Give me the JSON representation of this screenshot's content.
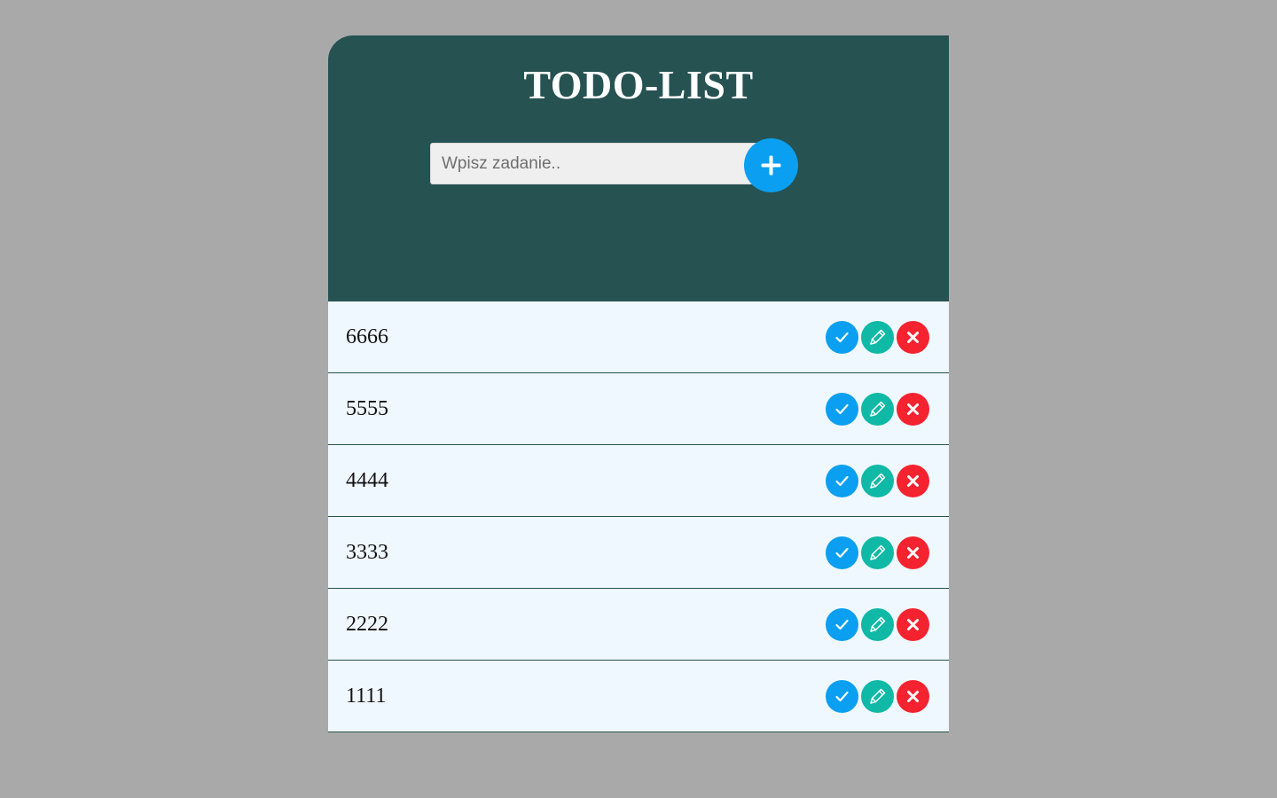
{
  "header": {
    "title": "TODO-LIST"
  },
  "form": {
    "placeholder": "Wpisz zadanie..",
    "value": ""
  },
  "icons": {
    "add": "plus-icon",
    "done": "check-icon",
    "edit": "pencil-icon",
    "delete": "close-icon"
  },
  "colors": {
    "header_bg": "#265252",
    "list_bg": "#f0f8ff",
    "done": "#0a9ff0",
    "edit": "#0fb9a6",
    "delete": "#f5232f"
  },
  "tasks": [
    {
      "text": "6666"
    },
    {
      "text": "5555"
    },
    {
      "text": "4444"
    },
    {
      "text": "3333"
    },
    {
      "text": "2222"
    },
    {
      "text": "1111"
    }
  ]
}
